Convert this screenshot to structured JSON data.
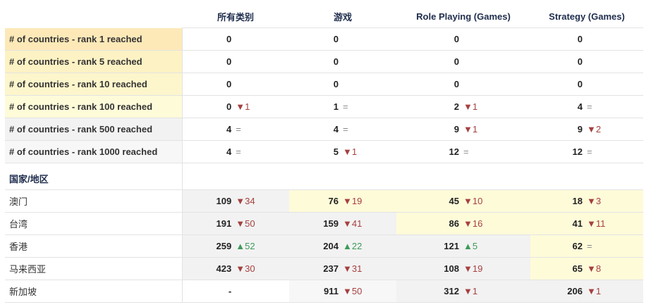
{
  "columns": [
    "所有类别",
    "游戏",
    "Role Playing (Games)",
    "Strategy (Games)"
  ],
  "summary_rows": [
    {
      "label": "# of countries - rank 1 reached",
      "bg": "#fde9b8",
      "cells": [
        {
          "v": "0",
          "d": "",
          "t": "none"
        },
        {
          "v": "0",
          "d": "",
          "t": "none"
        },
        {
          "v": "0",
          "d": "",
          "t": "none"
        },
        {
          "v": "0",
          "d": "",
          "t": "none"
        }
      ]
    },
    {
      "label": "# of countries - rank 5 reached",
      "bg": "#fdf2c4",
      "cells": [
        {
          "v": "0",
          "d": "",
          "t": "none"
        },
        {
          "v": "0",
          "d": "",
          "t": "none"
        },
        {
          "v": "0",
          "d": "",
          "t": "none"
        },
        {
          "v": "0",
          "d": "",
          "t": "none"
        }
      ]
    },
    {
      "label": "# of countries - rank 10 reached",
      "bg": "#fdf6cc",
      "cells": [
        {
          "v": "0",
          "d": "",
          "t": "none"
        },
        {
          "v": "0",
          "d": "",
          "t": "none"
        },
        {
          "v": "0",
          "d": "",
          "t": "none"
        },
        {
          "v": "0",
          "d": "",
          "t": "none"
        }
      ]
    },
    {
      "label": "# of countries - rank 100 reached",
      "bg": "#fefbd9",
      "cells": [
        {
          "v": "0",
          "d": "▼1",
          "t": "down"
        },
        {
          "v": "1",
          "d": "=",
          "t": "same"
        },
        {
          "v": "2",
          "d": "▼1",
          "t": "down"
        },
        {
          "v": "4",
          "d": "=",
          "t": "same"
        }
      ]
    },
    {
      "label": "# of countries - rank 500 reached",
      "bg": "#f2f2f2",
      "cells": [
        {
          "v": "4",
          "d": "=",
          "t": "same"
        },
        {
          "v": "4",
          "d": "=",
          "t": "same"
        },
        {
          "v": "9",
          "d": "▼1",
          "t": "down"
        },
        {
          "v": "9",
          "d": "▼2",
          "t": "down"
        }
      ]
    },
    {
      "label": "# of countries - rank 1000 reached",
      "bg": "#f7f7f7",
      "cells": [
        {
          "v": "4",
          "d": "=",
          "t": "same"
        },
        {
          "v": "5",
          "d": "▼1",
          "t": "down"
        },
        {
          "v": "12",
          "d": "=",
          "t": "same"
        },
        {
          "v": "12",
          "d": "=",
          "t": "same"
        }
      ]
    }
  ],
  "section_title": "国家/地区",
  "country_rows": [
    {
      "label": "澳门",
      "cells": [
        {
          "v": "109",
          "d": "▼34",
          "t": "down",
          "bg": "#f2f2f2"
        },
        {
          "v": "76",
          "d": "▼19",
          "t": "down",
          "bg": "#fefbd9"
        },
        {
          "v": "45",
          "d": "▼10",
          "t": "down",
          "bg": "#fefbd9"
        },
        {
          "v": "18",
          "d": "▼3",
          "t": "down",
          "bg": "#fefbd9"
        }
      ]
    },
    {
      "label": "台湾",
      "cells": [
        {
          "v": "191",
          "d": "▼50",
          "t": "down",
          "bg": "#f2f2f2"
        },
        {
          "v": "159",
          "d": "▼41",
          "t": "down",
          "bg": "#f2f2f2"
        },
        {
          "v": "86",
          "d": "▼16",
          "t": "down",
          "bg": "#fefbd9"
        },
        {
          "v": "41",
          "d": "▼11",
          "t": "down",
          "bg": "#fefbd9"
        }
      ]
    },
    {
      "label": "香港",
      "cells": [
        {
          "v": "259",
          "d": "▲52",
          "t": "up",
          "bg": "#f2f2f2"
        },
        {
          "v": "204",
          "d": "▲22",
          "t": "up",
          "bg": "#f2f2f2"
        },
        {
          "v": "121",
          "d": "▲5",
          "t": "up",
          "bg": "#f2f2f2"
        },
        {
          "v": "62",
          "d": "=",
          "t": "same",
          "bg": "#fefbd9"
        }
      ]
    },
    {
      "label": "马来西亚",
      "cells": [
        {
          "v": "423",
          "d": "▼30",
          "t": "down",
          "bg": "#f2f2f2"
        },
        {
          "v": "237",
          "d": "▼31",
          "t": "down",
          "bg": "#f2f2f2"
        },
        {
          "v": "108",
          "d": "▼19",
          "t": "down",
          "bg": "#f2f2f2"
        },
        {
          "v": "65",
          "d": "▼8",
          "t": "down",
          "bg": "#fefbd9"
        }
      ]
    },
    {
      "label": "新加坡",
      "cells": [
        {
          "v": "-",
          "d": "",
          "t": "none",
          "bg": "#ffffff"
        },
        {
          "v": "911",
          "d": "▼50",
          "t": "down",
          "bg": "#f7f7f7"
        },
        {
          "v": "312",
          "d": "▼1",
          "t": "down",
          "bg": "#f2f2f2"
        },
        {
          "v": "206",
          "d": "▼1",
          "t": "down",
          "bg": "#f2f2f2"
        }
      ]
    }
  ]
}
